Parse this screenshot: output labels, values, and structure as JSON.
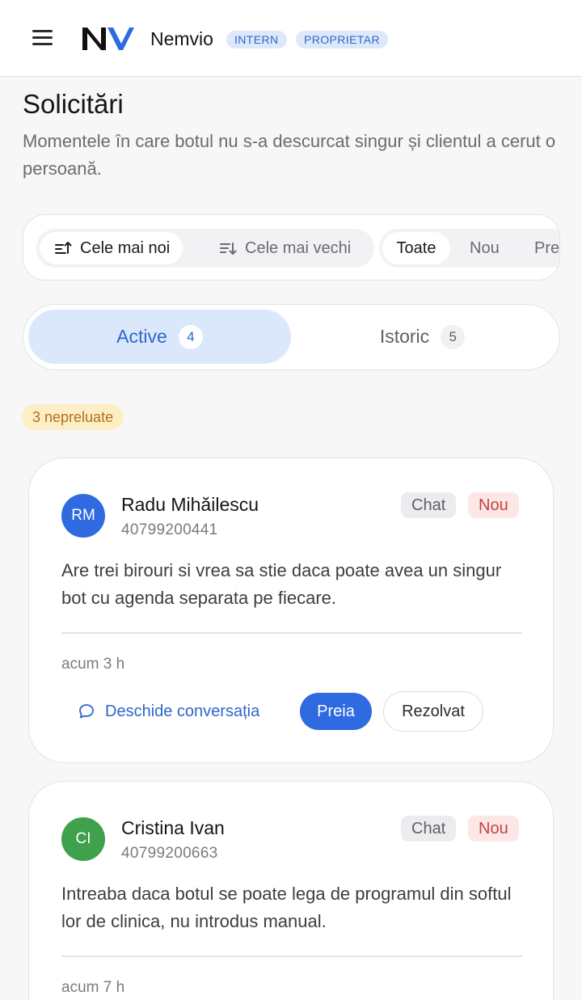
{
  "header": {
    "brand": "Nemvio",
    "tags": [
      "INTERN",
      "PROPRIETAR"
    ],
    "icons": {
      "menu": "hamburger-menu-icon",
      "logo": "nv-logo"
    }
  },
  "page": {
    "title": "Solicitări",
    "subtitle": "Momentele în care botul nu s-a descurcat singur și clientul a cerut o persoană."
  },
  "filters": {
    "sort": [
      {
        "label": "Cele mai noi",
        "icon": "sort-newest-icon",
        "active": true
      },
      {
        "label": "Cele mai vechi",
        "icon": "sort-oldest-icon",
        "active": false
      }
    ],
    "status": [
      {
        "label": "Toate",
        "active": true
      },
      {
        "label": "Nou",
        "active": false
      },
      {
        "label": "Pre",
        "active": false
      }
    ]
  },
  "tabs": [
    {
      "label": "Active",
      "count": "4",
      "active": true
    },
    {
      "label": "Istoric",
      "count": "5",
      "active": false
    }
  ],
  "unassigned_badge": "3 nepreluate",
  "requests": [
    {
      "initials": "RM",
      "avatar_color": "#2f6ae0",
      "name": "Radu Mihăilescu",
      "phone": "40799200441",
      "channel": "Chat",
      "status": "Nou",
      "message": "Are trei birouri si vrea sa stie daca poate avea un singur bot cu agenda separata pe fiecare.",
      "time": "acum 3 h",
      "actions": {
        "open": "Deschide conversația",
        "take": "Preia",
        "resolve": "Rezolvat"
      }
    },
    {
      "initials": "CI",
      "avatar_color": "#3fa14c",
      "name": "Cristina Ivan",
      "phone": "40799200663",
      "channel": "Chat",
      "status": "Nou",
      "message": "Intreaba daca botul se poate lega de programul din softul lor de clinica, nu introdus manual.",
      "time": "acum 7 h"
    }
  ],
  "colors": {
    "accent": "#2f66c9",
    "primary_button": "#2f6ae0",
    "active_tab_bg": "#dbe8fb",
    "new_badge_text": "#c94040",
    "unassigned_bg": "#fcefc6"
  }
}
